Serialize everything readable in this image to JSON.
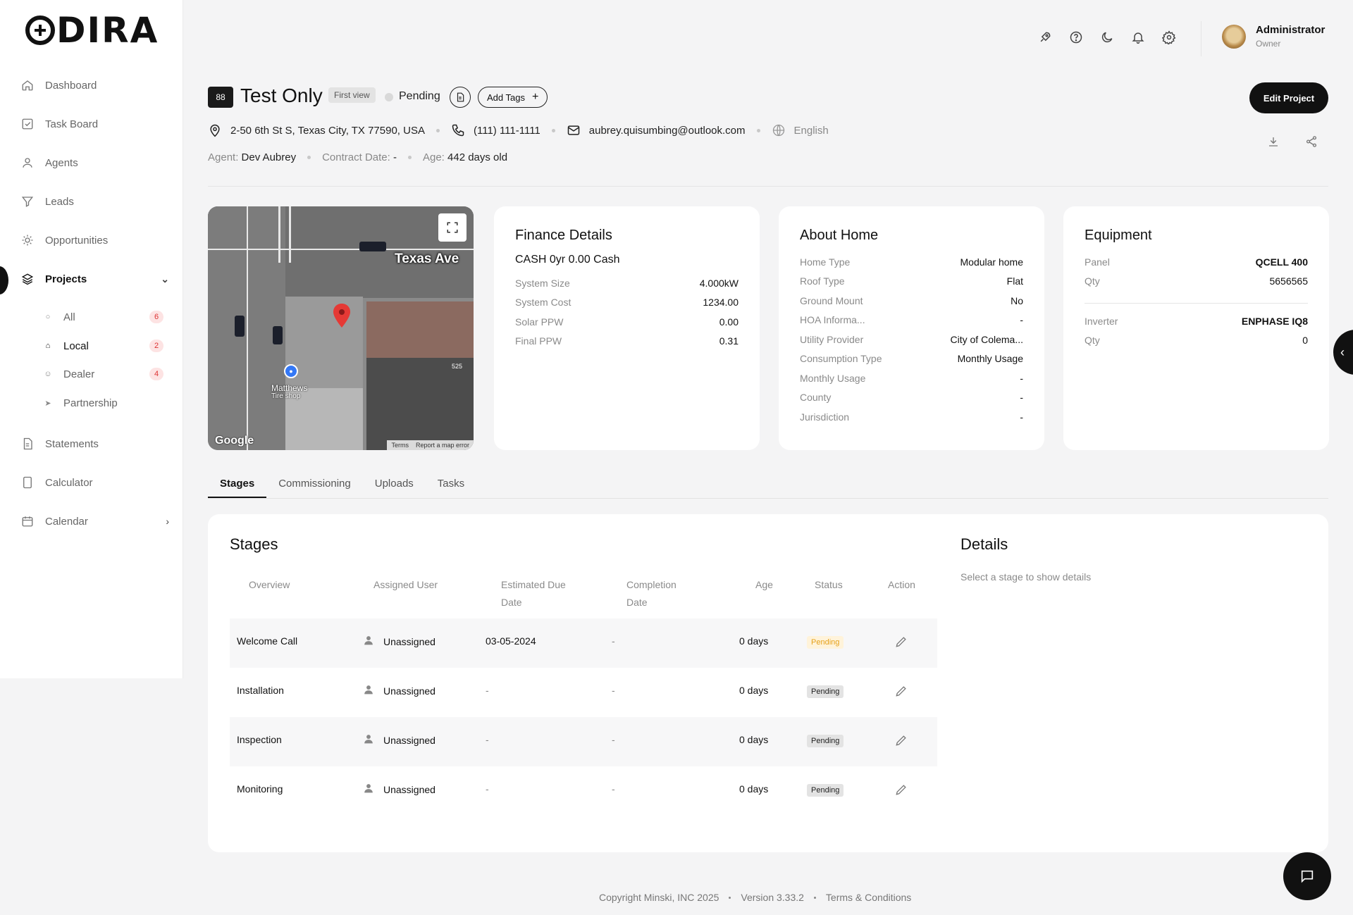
{
  "brand": {
    "logo": "ODIRA"
  },
  "sidebar": {
    "items": [
      {
        "label": "Dashboard",
        "icon": "home-icon"
      },
      {
        "label": "Task Board",
        "icon": "checkbox-icon"
      },
      {
        "label": "Agents",
        "icon": "user-icon"
      },
      {
        "label": "Leads",
        "icon": "filter-icon"
      },
      {
        "label": "Opportunities",
        "icon": "sun-icon"
      },
      {
        "label": "Projects",
        "icon": "layers-icon"
      },
      {
        "label": "Statements",
        "icon": "document-icon"
      },
      {
        "label": "Calculator",
        "icon": "calculator-icon"
      },
      {
        "label": "Calendar",
        "icon": "calendar-icon"
      }
    ],
    "project_sub": [
      {
        "label": "All",
        "count": "6"
      },
      {
        "label": "Local",
        "count": "2"
      },
      {
        "label": "Dealer",
        "count": "4"
      },
      {
        "label": "Partnership",
        "count": ""
      }
    ]
  },
  "user": {
    "name": "Administrator",
    "role": "Owner"
  },
  "project": {
    "number": "88",
    "title": "Test Only",
    "view_badge": "First view",
    "status": "Pending",
    "add_tags": "Add Tags",
    "edit_button": "Edit Project",
    "address": "2-50 6th St S, Texas City, TX 77590, USA",
    "phone": "(111) 111-1111",
    "email": "aubrey.quisumbing@outlook.com",
    "language": "English",
    "agent_label": "Agent:",
    "agent": "Dev Aubrey",
    "contract_label": "Contract Date:",
    "contract": "-",
    "age_label": "Age:",
    "age": "442 days old"
  },
  "map": {
    "street_label": "Texas Ave",
    "place_label": "Matthews",
    "place_sub": "Tire shop",
    "lot_number": "525",
    "google": "Google",
    "terms": "Terms",
    "report": "Report a map error"
  },
  "finance": {
    "title": "Finance Details",
    "plan": "CASH 0yr 0.00 Cash",
    "rows": [
      {
        "k": "System Size",
        "v": "4.000kW"
      },
      {
        "k": "System Cost",
        "v": "1234.00"
      },
      {
        "k": "Solar PPW",
        "v": "0.00"
      },
      {
        "k": "Final PPW",
        "v": "0.31"
      }
    ]
  },
  "home": {
    "title": "About Home",
    "rows": [
      {
        "k": "Home Type",
        "v": "Modular home"
      },
      {
        "k": "Roof Type",
        "v": "Flat"
      },
      {
        "k": "Ground Mount",
        "v": "No"
      },
      {
        "k": "HOA Informa...",
        "v": "-"
      },
      {
        "k": "Utility Provider",
        "v": "City of Colema..."
      },
      {
        "k": "Consumption Type",
        "v": "Monthly Usage"
      },
      {
        "k": "Monthly Usage",
        "v": "-"
      },
      {
        "k": "County",
        "v": "-"
      },
      {
        "k": "Jurisdiction",
        "v": "-"
      }
    ]
  },
  "equipment": {
    "title": "Equipment",
    "panel_label": "Panel",
    "panel": "QCELL 400",
    "qty_label": "Qty",
    "panel_qty": "5656565",
    "inverter_label": "Inverter",
    "inverter": "ENPHASE IQ8",
    "inverter_qty": "0"
  },
  "tabs": [
    "Stages",
    "Commissioning",
    "Uploads",
    "Tasks"
  ],
  "stages": {
    "title": "Stages",
    "headers": {
      "overview": "Overview",
      "assigned": "Assigned User",
      "due_1": "Estimated Due",
      "due_2": "Date",
      "comp_1": "Completion",
      "comp_2": "Date",
      "age": "Age",
      "status": "Status",
      "action": "Action"
    },
    "rows": [
      {
        "name": "Welcome Call",
        "user": "Unassigned",
        "due": "03-05-2024",
        "completion": "-",
        "age": "0 days",
        "status": "Pending"
      },
      {
        "name": "Installation",
        "user": "Unassigned",
        "due": "-",
        "completion": "-",
        "age": "0 days",
        "status": "Pending"
      },
      {
        "name": "Inspection",
        "user": "Unassigned",
        "due": "-",
        "completion": "-",
        "age": "0 days",
        "status": "Pending"
      },
      {
        "name": "Monitoring",
        "user": "Unassigned",
        "due": "-",
        "completion": "-",
        "age": "0 days",
        "status": "Pending"
      }
    ]
  },
  "details": {
    "title": "Details",
    "empty": "Select a stage to show details"
  },
  "footer": {
    "copyright": "Copyright Minski, INC 2025",
    "version": "Version 3.33.2",
    "terms": "Terms & Conditions"
  },
  "colors": {
    "accent": "#111111",
    "warn": "#e6a11a",
    "badge_red": "#d33333"
  }
}
